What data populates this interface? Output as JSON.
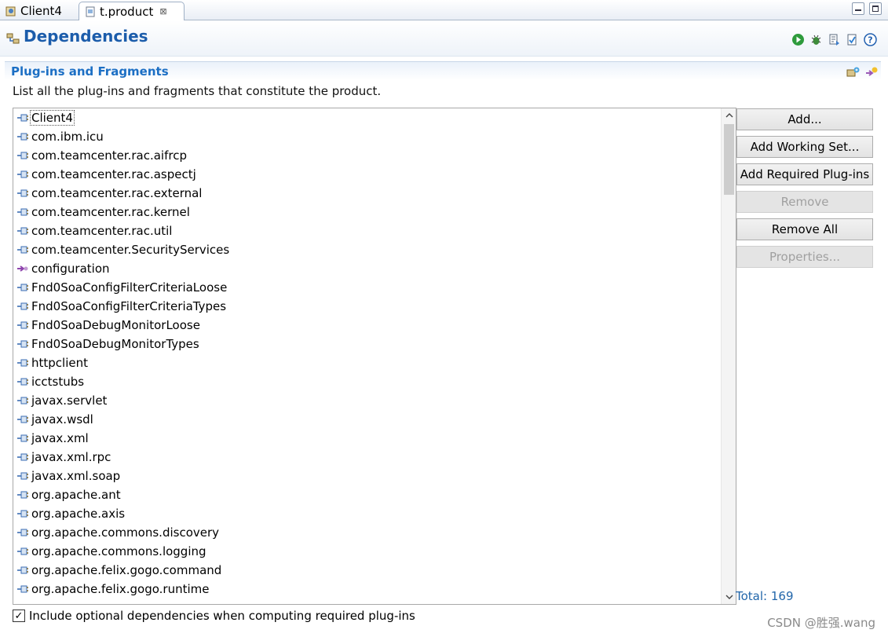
{
  "tabs": [
    {
      "label": "Client4",
      "icon": "plugin-project-icon",
      "active": false
    },
    {
      "label": "t.product",
      "icon": "product-file-icon",
      "active": true,
      "close": "⊠"
    }
  ],
  "page": {
    "title": "Dependencies",
    "toolbar": [
      "run-icon",
      "debug-icon",
      "export-icon",
      "validate-icon",
      "help-icon"
    ]
  },
  "section": {
    "title": "Plug-ins and Fragments",
    "description": "List all the plug-ins and fragments that constitute the product.",
    "items": [
      "Client4",
      "com.ibm.icu",
      "com.teamcenter.rac.aifrcp",
      "com.teamcenter.rac.aspectj",
      "com.teamcenter.rac.external",
      "com.teamcenter.rac.kernel",
      "com.teamcenter.rac.util",
      "com.teamcenter.SecurityServices",
      "configuration",
      "Fnd0SoaConfigFilterCriteriaLoose",
      "Fnd0SoaConfigFilterCriteriaTypes",
      "Fnd0SoaDebugMonitorLoose",
      "Fnd0SoaDebugMonitorTypes",
      "httpclient",
      "icctstubs",
      "javax.servlet",
      "javax.wsdl",
      "javax.xml",
      "javax.xml.rpc",
      "javax.xml.soap",
      "org.apache.ant",
      "org.apache.axis",
      "org.apache.commons.discovery",
      "org.apache.commons.logging",
      "org.apache.felix.gogo.command",
      "org.apache.felix.gogo.runtime"
    ],
    "buttons": {
      "add": "Add...",
      "add_working_set": "Add Working Set...",
      "add_required": "Add Required Plug-ins",
      "remove": "Remove",
      "remove_all": "Remove All",
      "properties": "Properties..."
    },
    "total": "Total: 169",
    "include_optional": {
      "label": "Include optional dependencies when computing required plug-ins",
      "checked": true
    }
  },
  "watermark": "CSDN @胜强.wang",
  "colors": {
    "title": "#1c5dab",
    "section_title": "#1c6fc4",
    "total": "#2266aa"
  }
}
